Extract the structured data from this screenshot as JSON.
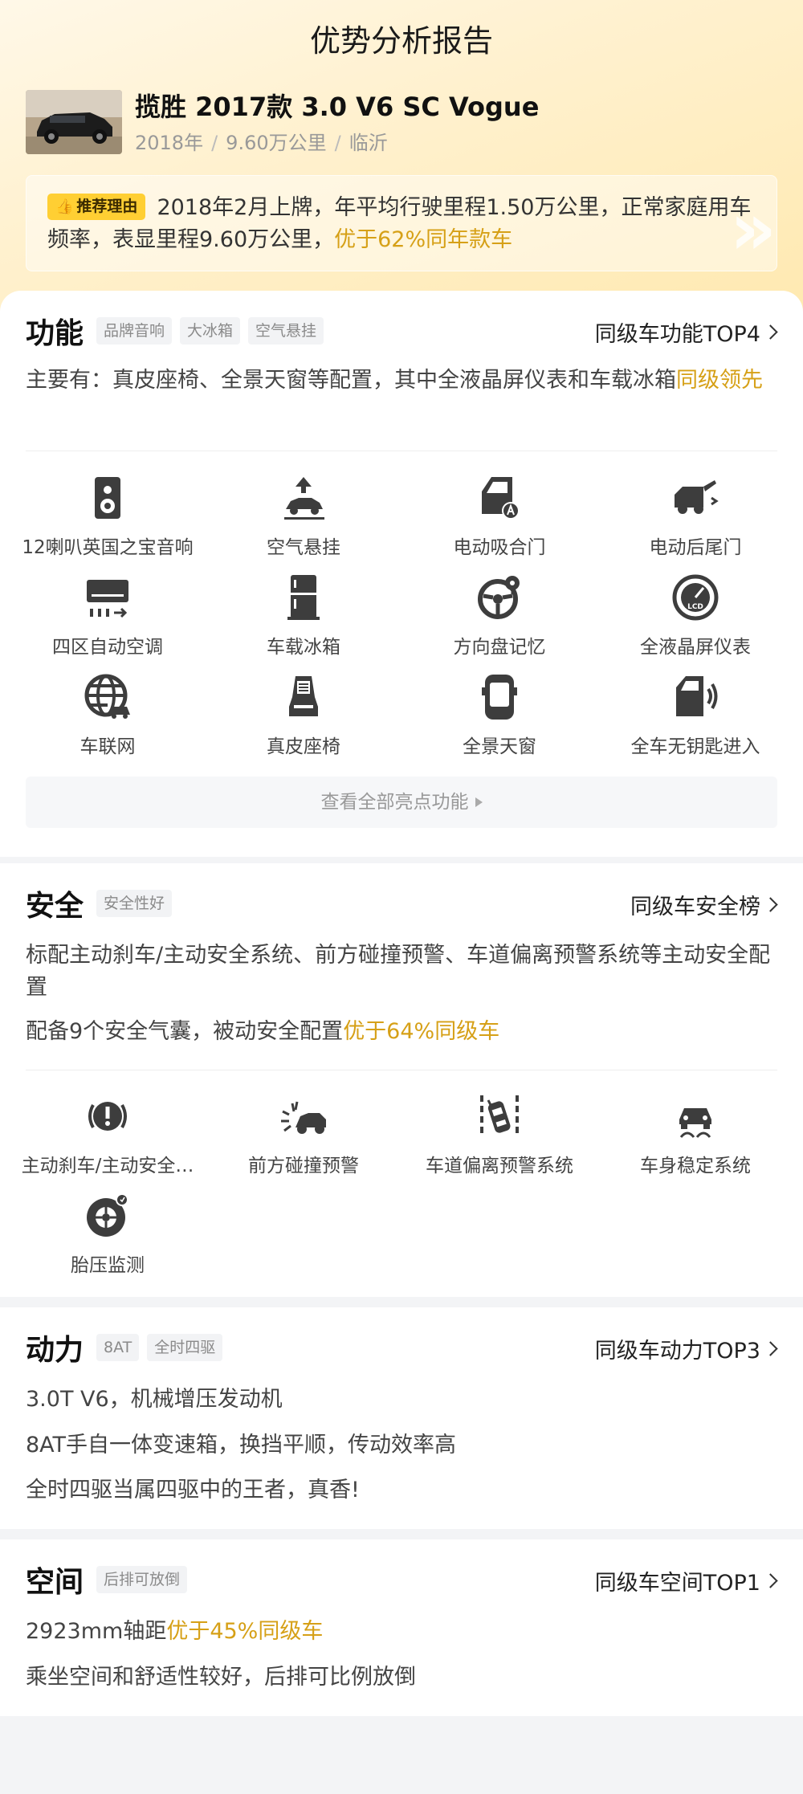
{
  "header": {
    "title": "优势分析报告"
  },
  "car": {
    "name": "揽胜 2017款 3.0 V6 SC Vogue",
    "year": "2018年",
    "mileage": "9.60万公里",
    "city": "临沂",
    "separator": "/"
  },
  "reason": {
    "badge": "推荐理由",
    "text": "2018年2月上牌，年平均行驶里程1.50万公里，正常家庭用车频率，表显里程9.60万公里，",
    "highlight": "优于62%同年款车"
  },
  "features": {
    "title": "功能",
    "tags": [
      "品牌音响",
      "大冰箱",
      "空气悬挂"
    ],
    "link": "同级车功能TOP4",
    "desc": "主要有：真皮座椅、全景天窗等配置，其中全液晶屏仪表和车载冰箱",
    "desc_highlight": "同级领先",
    "items": [
      {
        "label": "12喇叭英国之宝音响",
        "icon": "speaker-icon"
      },
      {
        "label": "空气悬挂",
        "icon": "air-suspension-icon"
      },
      {
        "label": "电动吸合门",
        "icon": "soft-close-door-icon"
      },
      {
        "label": "电动后尾门",
        "icon": "power-tailgate-icon"
      },
      {
        "label": "四区自动空调",
        "icon": "air-conditioner-icon"
      },
      {
        "label": "车载冰箱",
        "icon": "fridge-icon"
      },
      {
        "label": "方向盘记忆",
        "icon": "steering-memory-icon"
      },
      {
        "label": "全液晶屏仪表",
        "icon": "lcd-gauge-icon"
      },
      {
        "label": "车联网",
        "icon": "connected-car-icon"
      },
      {
        "label": "真皮座椅",
        "icon": "leather-seat-icon"
      },
      {
        "label": "全景天窗",
        "icon": "panoramic-sunroof-icon"
      },
      {
        "label": "全车无钥匙进入",
        "icon": "keyless-entry-icon"
      }
    ],
    "view_all": "查看全部亮点功能"
  },
  "safety": {
    "title": "安全",
    "tags": [
      "安全性好"
    ],
    "link": "同级车安全榜",
    "desc": "标配主动刹车/主动安全系统、前方碰撞预警、车道偏离预警系统等主动安全配置",
    "airbag_text": "配备9个安全气囊，被动安全配置",
    "airbag_highlight": "优于64%同级车",
    "items": [
      {
        "label": "主动刹车/主动安全…",
        "icon": "active-brake-icon"
      },
      {
        "label": "前方碰撞预警",
        "icon": "collision-warning-icon"
      },
      {
        "label": "车道偏离预警系统",
        "icon": "lane-departure-icon"
      },
      {
        "label": "车身稳定系统",
        "icon": "stability-control-icon"
      },
      {
        "label": "胎压监测",
        "icon": "tire-pressure-icon"
      }
    ]
  },
  "power": {
    "title": "动力",
    "tags": [
      "8AT",
      "全时四驱"
    ],
    "link": "同级车动力TOP3",
    "lines": [
      "3.0T V6，机械增压发动机",
      "8AT手自一体变速箱，换挡平顺，传动效率高",
      "全时四驱当属四驱中的王者，真香!"
    ]
  },
  "space": {
    "title": "空间",
    "tags": [
      "后排可放倒"
    ],
    "link": "同级车空间TOP1",
    "wheelbase": "2923mm轴距",
    "wheelbase_highlight": "优于45%同级车",
    "comfort": "乘坐空间和舒适性较好，后排可比例放倒"
  }
}
